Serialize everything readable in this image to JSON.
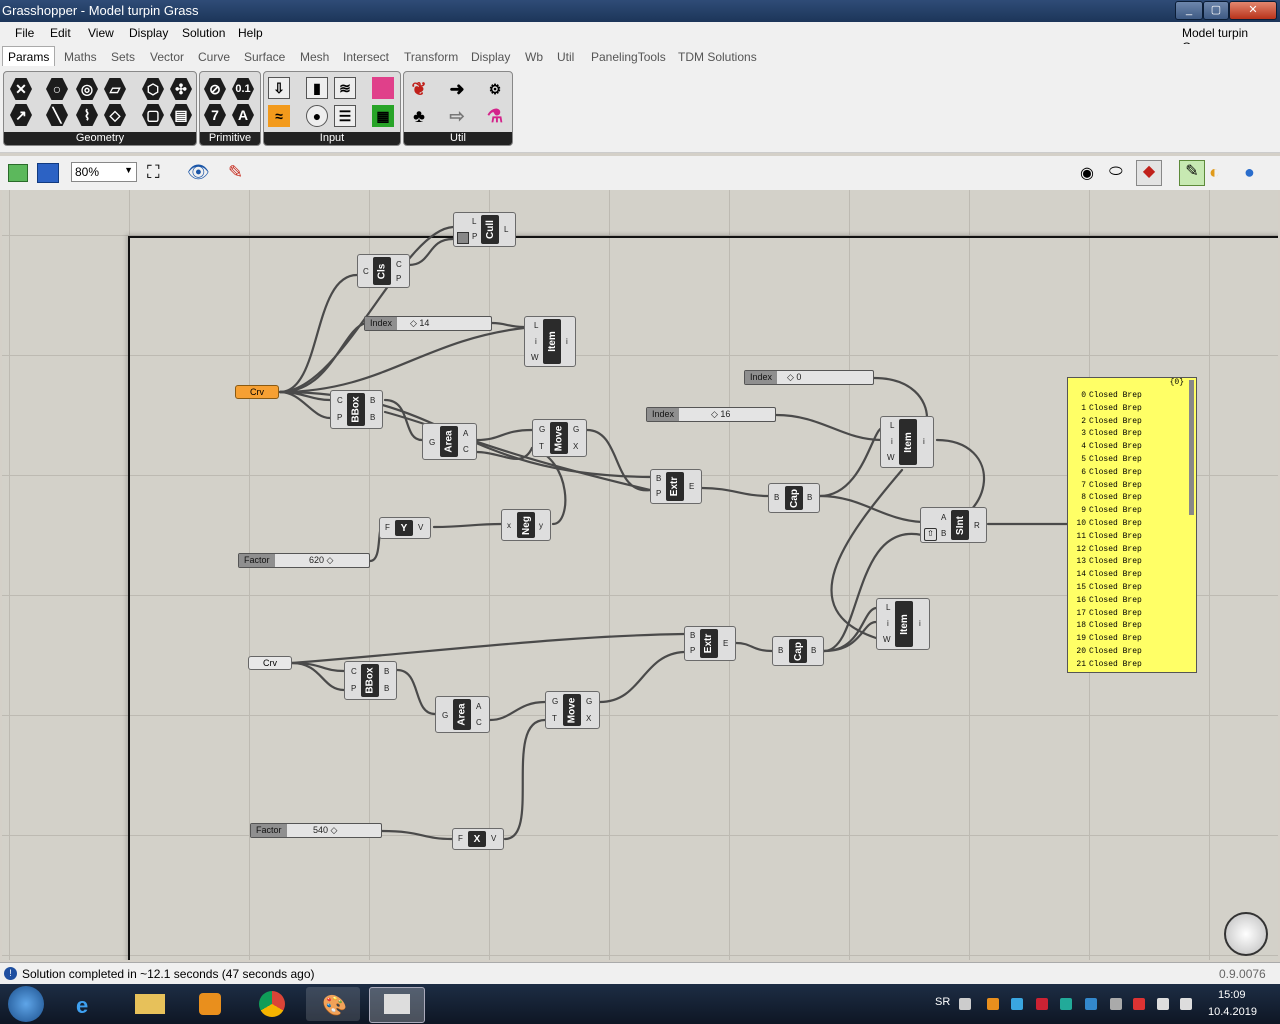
{
  "window": {
    "title": "Grasshopper - Model turpin Grass",
    "doc_name": "Model turpin Grass"
  },
  "menu": [
    "File",
    "Edit",
    "View",
    "Display",
    "Solution",
    "Help"
  ],
  "tabs": [
    "Params",
    "Maths",
    "Sets",
    "Vector",
    "Curve",
    "Surface",
    "Mesh",
    "Intersect",
    "Transform",
    "Display",
    "Wb",
    "Util",
    "PanelingTools",
    "TDM Solutions"
  ],
  "panels": [
    "Geometry",
    "Primitive",
    "Input",
    "Util"
  ],
  "primitive_icons": [
    "0.1",
    "7",
    "A"
  ],
  "canvas_toolbar": {
    "zoom": "80%"
  },
  "nodes": {
    "crv1": "Crv",
    "crv2": "Crv",
    "cull": {
      "name": "Cull",
      "in": [
        "L",
        "P"
      ],
      "out": [
        "L"
      ]
    },
    "cls": {
      "name": "Cls",
      "in": [
        "C"
      ],
      "out": [
        "C",
        "P"
      ]
    },
    "item1": {
      "name": "Item",
      "in": [
        "L",
        "i",
        "W"
      ],
      "out": [
        "i"
      ]
    },
    "item2": {
      "name": "Item",
      "in": [
        "L",
        "i",
        "W"
      ],
      "out": [
        "i"
      ]
    },
    "item3": {
      "name": "Item",
      "in": [
        "L",
        "i",
        "W"
      ],
      "out": [
        "i"
      ]
    },
    "bbox1": {
      "name": "BBox",
      "in": [
        "C",
        "P"
      ],
      "out": [
        "B",
        "B"
      ]
    },
    "bbox2": {
      "name": "BBox",
      "in": [
        "C",
        "P"
      ],
      "out": [
        "B",
        "B"
      ]
    },
    "area1": {
      "name": "Area",
      "in": [
        "G"
      ],
      "out": [
        "A",
        "C"
      ]
    },
    "area2": {
      "name": "Area",
      "in": [
        "G"
      ],
      "out": [
        "A",
        "C"
      ]
    },
    "move1": {
      "name": "Move",
      "in": [
        "G",
        "T"
      ],
      "out": [
        "G",
        "X"
      ]
    },
    "move2": {
      "name": "Move",
      "in": [
        "G",
        "T"
      ],
      "out": [
        "G",
        "X"
      ]
    },
    "extr1": {
      "name": "Extr",
      "in": [
        "B",
        "P"
      ],
      "out": [
        "E"
      ]
    },
    "extr2": {
      "name": "Extr",
      "in": [
        "B",
        "P"
      ],
      "out": [
        "E"
      ]
    },
    "cap1": {
      "name": "Cap",
      "in": [
        "B"
      ],
      "out": [
        "B"
      ]
    },
    "cap2": {
      "name": "Cap",
      "in": [
        "B"
      ],
      "out": [
        "B"
      ]
    },
    "sint": {
      "name": "SInt",
      "in": [
        "A",
        "B"
      ],
      "out": [
        "R"
      ]
    },
    "neg": {
      "name": "Neg",
      "in": [
        "x"
      ],
      "out": [
        "y"
      ]
    },
    "unity": {
      "name": "Y",
      "in": [
        "F"
      ],
      "out": [
        "V"
      ]
    },
    "unitx": {
      "name": "X",
      "in": [
        "F"
      ],
      "out": [
        "V"
      ]
    }
  },
  "sliders": {
    "index14": {
      "label": "Index",
      "value": "14"
    },
    "index0": {
      "label": "Index",
      "value": "0"
    },
    "index16": {
      "label": "Index",
      "value": "16"
    },
    "factor620": {
      "label": "Factor",
      "value": "620"
    },
    "factor540": {
      "label": "Factor",
      "value": "540"
    }
  },
  "panel_output": {
    "header": "{0}",
    "rows": [
      {
        "i": "0",
        "t": "Closed Brep"
      },
      {
        "i": "1",
        "t": "Closed Brep"
      },
      {
        "i": "2",
        "t": "Closed Brep"
      },
      {
        "i": "3",
        "t": "Closed Brep"
      },
      {
        "i": "4",
        "t": "Closed Brep"
      },
      {
        "i": "5",
        "t": "Closed Brep"
      },
      {
        "i": "6",
        "t": "Closed Brep"
      },
      {
        "i": "7",
        "t": "Closed Brep"
      },
      {
        "i": "8",
        "t": "Closed Brep"
      },
      {
        "i": "9",
        "t": "Closed Brep"
      },
      {
        "i": "10",
        "t": "Closed Brep"
      },
      {
        "i": "11",
        "t": "Closed Brep"
      },
      {
        "i": "12",
        "t": "Closed Brep"
      },
      {
        "i": "13",
        "t": "Closed Brep"
      },
      {
        "i": "14",
        "t": "Closed Brep"
      },
      {
        "i": "15",
        "t": "Closed Brep"
      },
      {
        "i": "16",
        "t": "Closed Brep"
      },
      {
        "i": "17",
        "t": "Closed Brep"
      },
      {
        "i": "18",
        "t": "Closed Brep"
      },
      {
        "i": "19",
        "t": "Closed Brep"
      },
      {
        "i": "20",
        "t": "Closed Brep"
      },
      {
        "i": "21",
        "t": "Closed Brep"
      }
    ]
  },
  "status": {
    "message": "Solution completed in ~12.1 seconds (47 seconds ago)",
    "version": "0.9.0076"
  },
  "taskbar": {
    "lang": "SR",
    "time": "15:09",
    "date": "10.4.2019"
  },
  "colors": {
    "selected_param": "#f6a033",
    "panel_yellow": "#ffff66",
    "canvas": "#d3d1c9"
  }
}
